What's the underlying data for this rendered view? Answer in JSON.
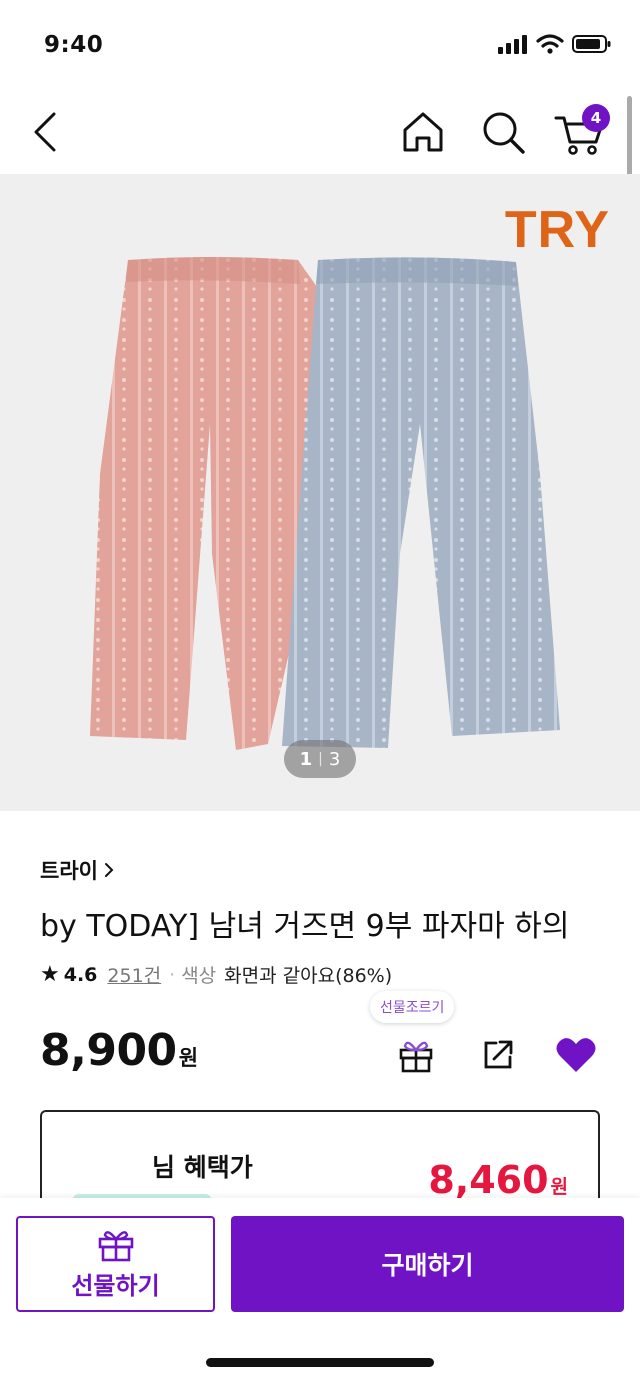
{
  "status_bar": {
    "time": "9:40"
  },
  "nav": {
    "cart_count": "4"
  },
  "hero": {
    "brand_logo": "TRY",
    "counter_current": "1",
    "counter_total": "3"
  },
  "product": {
    "brand": "트라이",
    "title": "by TODAY] 남녀 거즈면 9부 파자마 하의",
    "rating": "4.6",
    "review_count": "251건",
    "color_label": "색상",
    "color_value": "화면과 같아요(86%)",
    "price_amount": "8,900",
    "price_unit": "원",
    "gift_tooltip": "선물조르기"
  },
  "benefit": {
    "label": "님 혜택가",
    "price_amount": "8,460",
    "price_unit": "원"
  },
  "bottom": {
    "gift_label": "선물하기",
    "buy_label": "구매하기"
  },
  "colors": {
    "brand_purple": "#6f13c4",
    "price_red": "#e5173f",
    "logo_orange": "#de6418",
    "pants_pink": "#e2a39b",
    "pants_blue": "#a7b5c7"
  }
}
